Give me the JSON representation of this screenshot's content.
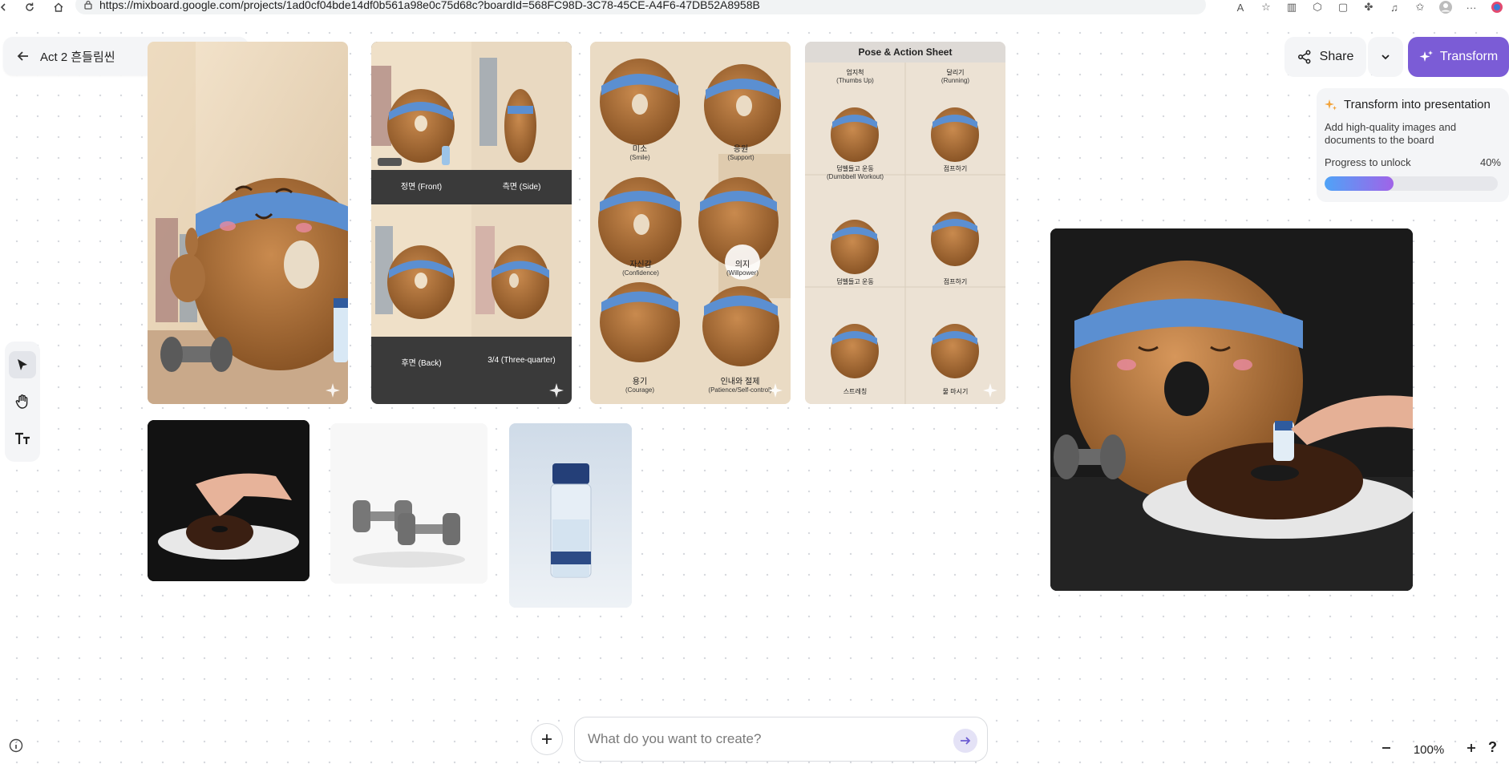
{
  "browser": {
    "url": "https://mixboard.google.com/projects/1ad0cf04bde14df0b561a98e0c75d68c?boardId=568FC98D-3C78-45CE-A4F6-47DB52A8958B"
  },
  "board": {
    "title": "Act 2 흔들림씬"
  },
  "cards": {
    "turnaround": {
      "front": "정면 (Front)",
      "side": "측면 (Side)",
      "back": "후면 (Back)",
      "three_quarter": "3/4 (Three-quarter)"
    },
    "emotions": {
      "smile": "미소",
      "smile_en": "(Smile)",
      "support": "응원",
      "support_en": "(Support)",
      "confidence": "자신감",
      "confidence_en": "(Confidence)",
      "willpower": "의지",
      "willpower_en": "(Willpower)",
      "courage": "용기",
      "courage_en": "(Courage)",
      "patience": "인내와 절제",
      "patience_en": "(Patience/Self-control)"
    },
    "pose_sheet": {
      "title": "Pose & Action Sheet",
      "p1": "엄지척",
      "p1_en": "(Thumbs Up)",
      "p2": "달리기",
      "p2_en": "(Running)",
      "p3": "덤벨들고 운동",
      "p3_en": "(Dumbbell Workout)",
      "p4": "점프하기",
      "p5": "덤벨들고 운동",
      "p6": "점프하기",
      "p7": "스트레칭",
      "p8": "물 마시기"
    }
  },
  "toolbar": {
    "tools": [
      "select",
      "hand",
      "text"
    ]
  },
  "header": {
    "share_label": "Share",
    "transform_label": "Transform"
  },
  "transform_panel": {
    "title": "Transform into presentation",
    "description": "Add high-quality images and documents to the board",
    "progress_label": "Progress to unlock",
    "progress_text": "40%",
    "progress_value": 0.4
  },
  "prompt": {
    "placeholder": "What do you want to create?"
  },
  "zoom": {
    "level": "100%"
  },
  "colors": {
    "accent": "#7b5cd6",
    "progress_start": "#4fa3f7",
    "progress_end": "#a063e8"
  }
}
